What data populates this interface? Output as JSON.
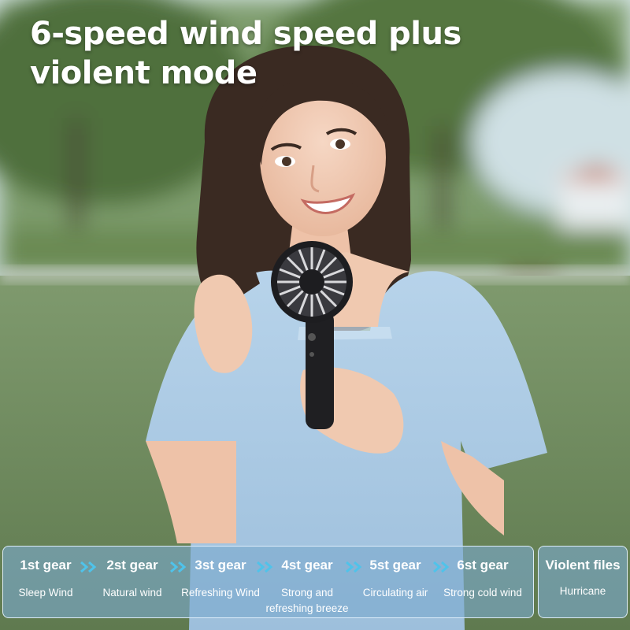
{
  "headline": {
    "line1": "6-speed wind speed plus",
    "line2": "violent mode"
  },
  "gears": [
    {
      "title": "1st gear",
      "desc": "Sleep Wind"
    },
    {
      "title": "2st gear",
      "desc": "Natural wind"
    },
    {
      "title": "3st gear",
      "desc": "Refreshing Wind"
    },
    {
      "title": "4st gear",
      "desc": "Strong and refreshing breeze"
    },
    {
      "title": "5st gear",
      "desc": "Circulating air"
    },
    {
      "title": "6st gear",
      "desc": "Strong cold wind"
    }
  ],
  "violent": {
    "title": "Violent files",
    "desc": "Hurricane"
  },
  "colors": {
    "panel_fill": "#7aaacd",
    "panel_border": "#e1f0fc",
    "chevron": "#4fc3ea",
    "text": "#ffffff"
  }
}
